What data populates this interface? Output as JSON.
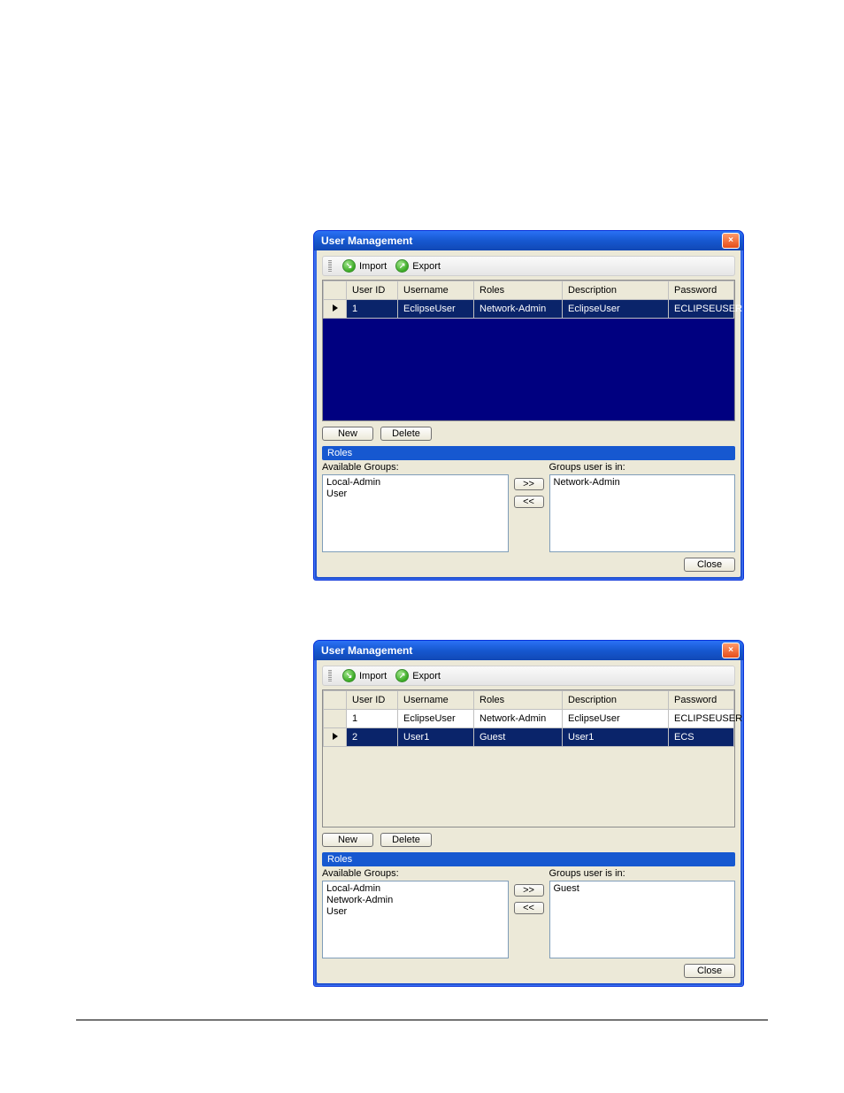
{
  "colors": {
    "accent": "#1658d0",
    "selection": "#0a246a"
  },
  "toolbar": {
    "import_label": "Import",
    "export_label": "Export"
  },
  "grid_headers": {
    "user_id": "User ID",
    "username": "Username",
    "roles": "Roles",
    "description": "Description",
    "password": "Password"
  },
  "buttons": {
    "new": "New",
    "delete": "Delete",
    "close": "Close",
    "move_right": ">>",
    "move_left": "<<"
  },
  "labels": {
    "roles_section": "Roles",
    "available_groups": "Available Groups:",
    "groups_user_in": "Groups user is in:"
  },
  "win1": {
    "title": "User Management",
    "rows": [
      {
        "id": "1",
        "username": "EclipseUser",
        "roles": "Network-Admin",
        "description": "EclipseUser",
        "password": "ECLIPSEUSER",
        "selected": true
      }
    ],
    "available_groups": [
      "Local-Admin",
      "User"
    ],
    "user_groups": [
      "Network-Admin"
    ]
  },
  "win2": {
    "title": "User Management",
    "rows": [
      {
        "id": "1",
        "username": "EclipseUser",
        "roles": "Network-Admin",
        "description": "EclipseUser",
        "password": "ECLIPSEUSER",
        "selected": false
      },
      {
        "id": "2",
        "username": "User1",
        "roles": "Guest",
        "description": "User1",
        "password": "ECS",
        "selected": true
      }
    ],
    "available_groups": [
      "Local-Admin",
      "Network-Admin",
      "User"
    ],
    "user_groups": [
      "Guest"
    ]
  }
}
